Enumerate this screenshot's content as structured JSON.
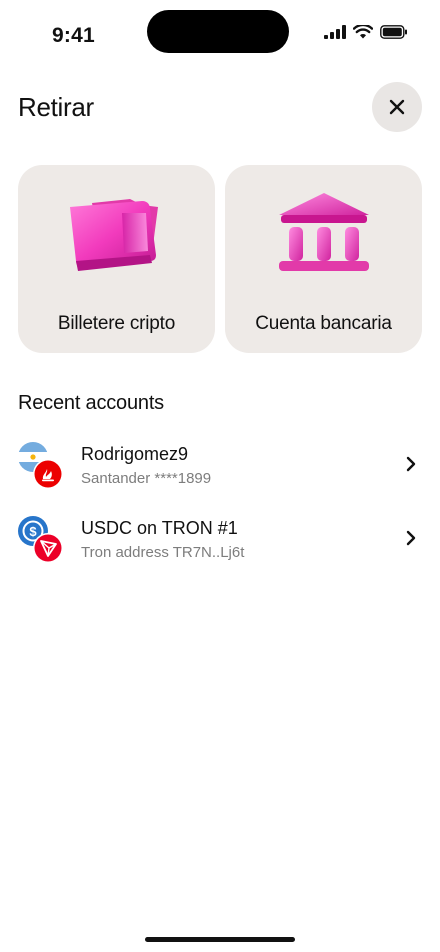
{
  "status_bar": {
    "time": "9:41",
    "icons": [
      "signal-icon",
      "wifi-icon",
      "battery-icon"
    ]
  },
  "header": {
    "title": "Retirar",
    "close_icon": "close-icon"
  },
  "options": [
    {
      "label": "Billetere cripto",
      "icon": "wallet-icon"
    },
    {
      "label": "Cuenta bancaria",
      "icon": "bank-icon"
    }
  ],
  "recent": {
    "title": "Recent accounts",
    "items": [
      {
        "name": "Rodrigomez9",
        "detail": "Santander ****1899",
        "icons": [
          "argentina-flag-icon",
          "santander-icon"
        ]
      },
      {
        "name": "USDC on TRON #1",
        "detail": "Tron address TR7N..Lj6t",
        "icons": [
          "usdc-icon",
          "tron-icon"
        ]
      }
    ]
  },
  "colors": {
    "card_bg": "#eeeae7",
    "accent_pink": "#f23bbd",
    "close_bg": "#e9e6e4"
  }
}
